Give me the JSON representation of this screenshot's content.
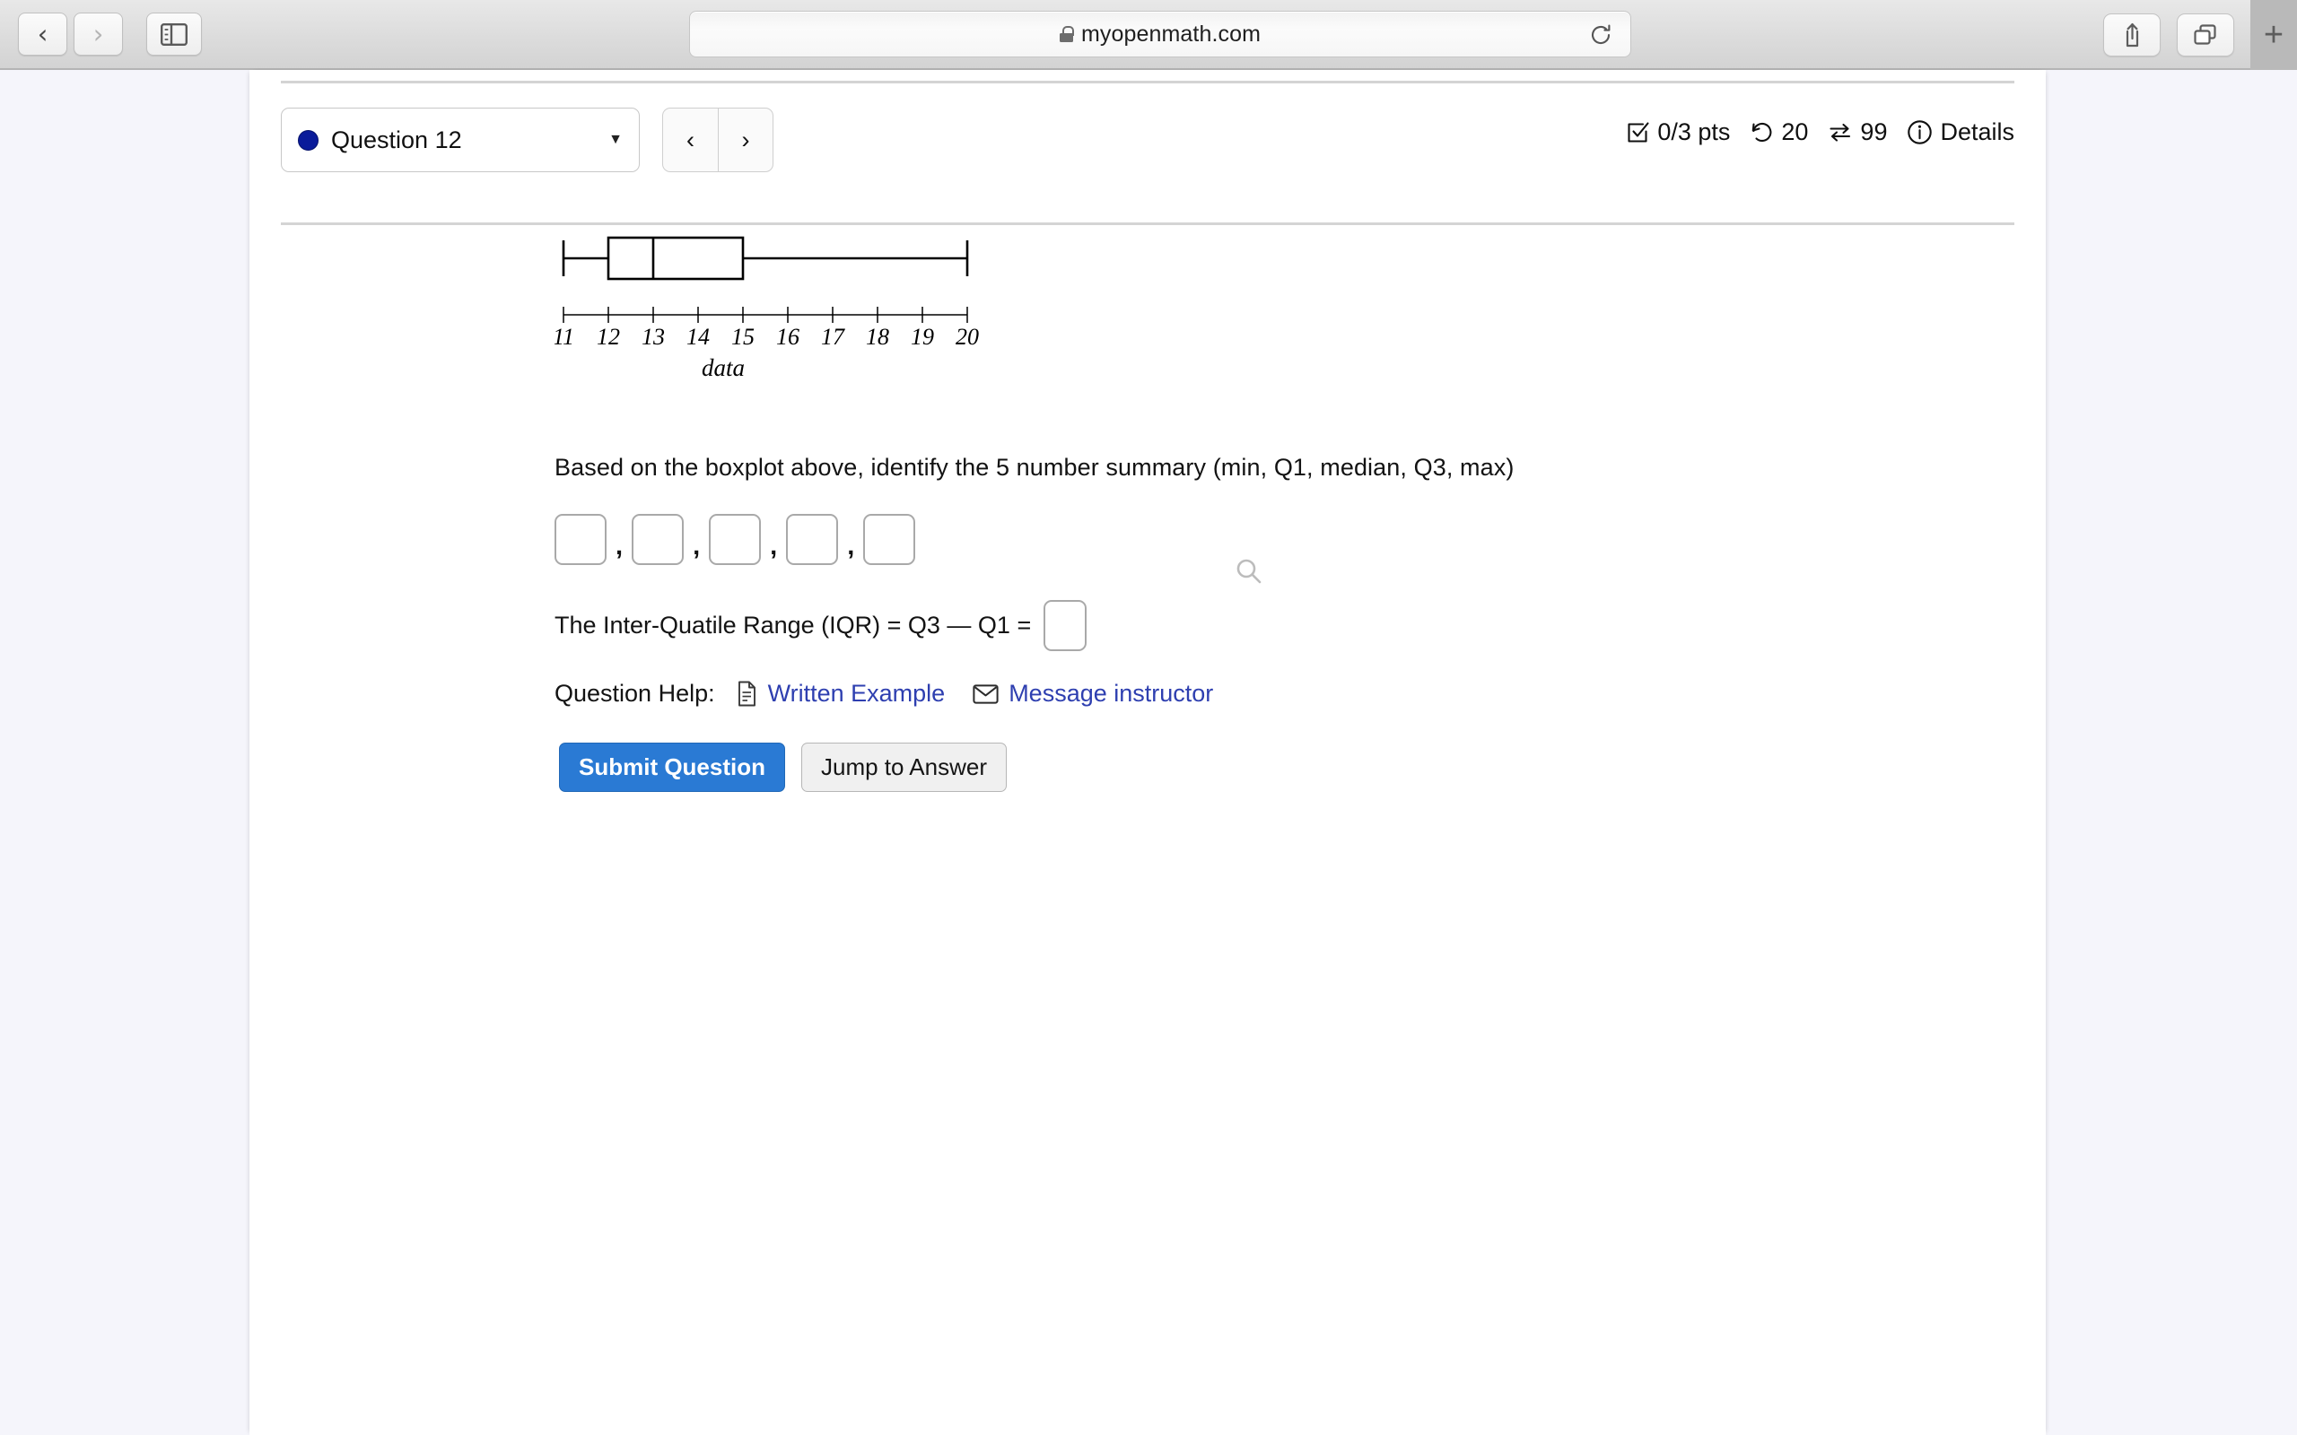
{
  "browser": {
    "back_icon": "chevron-left-icon",
    "forward_icon": "chevron-right-icon",
    "sidebar_icon": "sidebar-toggle-icon",
    "url": "myopenmath.com",
    "lock_icon": "lock-icon",
    "reload_icon": "reload-icon",
    "share_icon": "share-icon",
    "tabs_icon": "tab-overview-icon",
    "new_tab_label": "+"
  },
  "question_header": {
    "selected_question": "Question 12",
    "status_dot_color": "#0a1b9a",
    "caret_icon": "chevron-down-icon",
    "prev_label": "‹",
    "next_label": "›",
    "points": "0/3 pts",
    "points_icon": "checkbox-check-icon",
    "attempts": "20",
    "attempts_icon": "undo-arrow-icon",
    "versions": "99",
    "versions_icon": "swap-arrows-icon",
    "details_label": "Details",
    "details_icon": "info-circle-icon"
  },
  "chart_data": {
    "type": "boxplot",
    "title": "",
    "xlabel": "data",
    "ylabel": "",
    "xlim": [
      11,
      20
    ],
    "xticks": [
      11,
      12,
      13,
      14,
      15,
      16,
      17,
      18,
      19,
      20
    ],
    "xticklabels": [
      "11",
      "12",
      "13",
      "14",
      "15",
      "16",
      "17",
      "18",
      "19",
      "20"
    ],
    "grid": false,
    "legend": false,
    "series": [
      {
        "name": "data",
        "min": 11,
        "q1": 12,
        "median": 13,
        "q3": 15,
        "max": 20
      }
    ],
    "zoom_icon": "magnifier-icon"
  },
  "question_body": {
    "prompt": "Based on the boxplot above, identify the 5 number summary (min, Q1, median, Q3, max)",
    "separator": ",",
    "answers": [
      {
        "name": "min",
        "value": "",
        "placeholder": ""
      },
      {
        "name": "q1",
        "value": "",
        "placeholder": ""
      },
      {
        "name": "median",
        "value": "",
        "placeholder": ""
      },
      {
        "name": "q3",
        "value": "",
        "placeholder": ""
      },
      {
        "name": "max",
        "value": "",
        "placeholder": ""
      }
    ],
    "iqr_label": "The Inter-Quatile Range (IQR) = Q3 — Q1 =",
    "iqr_value": "",
    "iqr_placeholder": ""
  },
  "question_help": {
    "label": "Question Help:",
    "written_example": "Written Example",
    "written_example_icon": "document-icon",
    "message_instructor": "Message instructor",
    "message_instructor_icon": "envelope-icon",
    "link_color": "#2e3fb0"
  },
  "actions": {
    "submit_label": "Submit Question",
    "submit_color": "#2a7ad4",
    "jump_label": "Jump to Answer"
  }
}
